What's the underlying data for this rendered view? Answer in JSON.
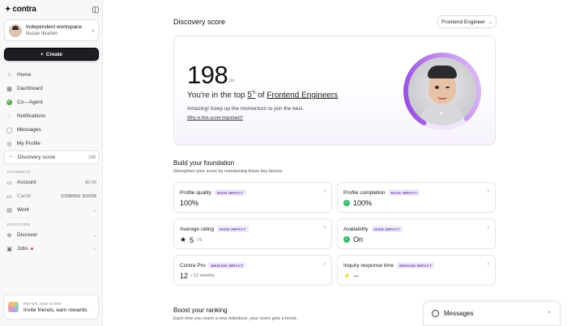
{
  "brand": {
    "logo": "contra",
    "star": "✦"
  },
  "workspace": {
    "title": "Independent workspace",
    "user": "Nuzair Ibrahim",
    "chevron": "›"
  },
  "create": {
    "label": "Create",
    "icon": "+"
  },
  "nav_main": [
    {
      "label": "Home",
      "icon": "⌂"
    },
    {
      "label": "Dashboard",
      "icon": "▦"
    },
    {
      "label": "Co—Agent",
      "icon": ""
    },
    {
      "label": "Notifications",
      "icon": "◌"
    },
    {
      "label": "Messages",
      "icon": "◯"
    },
    {
      "label": "My Profile",
      "icon": "◎"
    },
    {
      "label": "Discovery score",
      "icon": "◔",
      "right": "198"
    }
  ],
  "payments": {
    "label": "PAYMENTS",
    "items": [
      {
        "label": "Account",
        "icon": "▭",
        "right": "$0.00"
      },
      {
        "label": "Cards",
        "icon": "▭",
        "right": "COMING SOON"
      },
      {
        "label": "Work",
        "icon": "▤",
        "right": "⌄"
      }
    ]
  },
  "discover": {
    "label": "DISCOVER",
    "items": [
      {
        "label": "Discover",
        "icon": "⊕",
        "right": "⌄"
      },
      {
        "label": "Jobs",
        "icon": "▣",
        "right": "⌄"
      }
    ]
  },
  "refer": {
    "title": "REFER AND EARN",
    "subtitle": "Invite friends, earn rewards."
  },
  "header": {
    "title": "Discovery score",
    "role": "Frontend Engineer",
    "chevron": "⌄"
  },
  "score": {
    "value": "198",
    "unit": "pts",
    "line_prefix": "You're in the top",
    "percent": "5",
    "percent_sup": "%",
    "line_mid": "of",
    "group": "Frontend Engineers",
    "message": "Amazing! Keep up the momentum to join the best.",
    "link": "Why is this score important?",
    "ring_fraction": 0.8
  },
  "foundation": {
    "title": "Build your foundation",
    "subtitle": "Strengthen your score by maintaining these key factors."
  },
  "tiles": [
    {
      "title": "Profile quality",
      "badge": "HIGH IMPACT",
      "value": "100%",
      "icon": ""
    },
    {
      "title": "Profile completion",
      "badge": "HIGH IMPACT",
      "value": "100%",
      "icon": "check"
    },
    {
      "title": "Average rating",
      "badge": "HIGH IMPACT",
      "value": "5",
      "suffix": "/ 5",
      "icon": "★"
    },
    {
      "title": "Availability",
      "badge": "HIGH IMPACT",
      "value": "On",
      "icon": "check"
    },
    {
      "title": "Contra Pro",
      "badge": "MEDIUM IMPACT",
      "value": "12",
      "suffix": "/ 12 months",
      "icon": ""
    },
    {
      "title": "Inquiry response time",
      "badge": "MEDIUM IMPACT",
      "value": "--",
      "icon": "⚡"
    }
  ],
  "boost": {
    "title": "Boost your ranking",
    "subtitle": "Each time you reach a new milestone, your score gets a boost."
  },
  "messages_panel": {
    "label": "Messages",
    "chevron": "⌃"
  },
  "colors": {
    "accent": "#9b5de5",
    "ring_start": "#e7c8f7",
    "ring_end": "#8b3fd9",
    "create_bg": "#1d1d24"
  }
}
